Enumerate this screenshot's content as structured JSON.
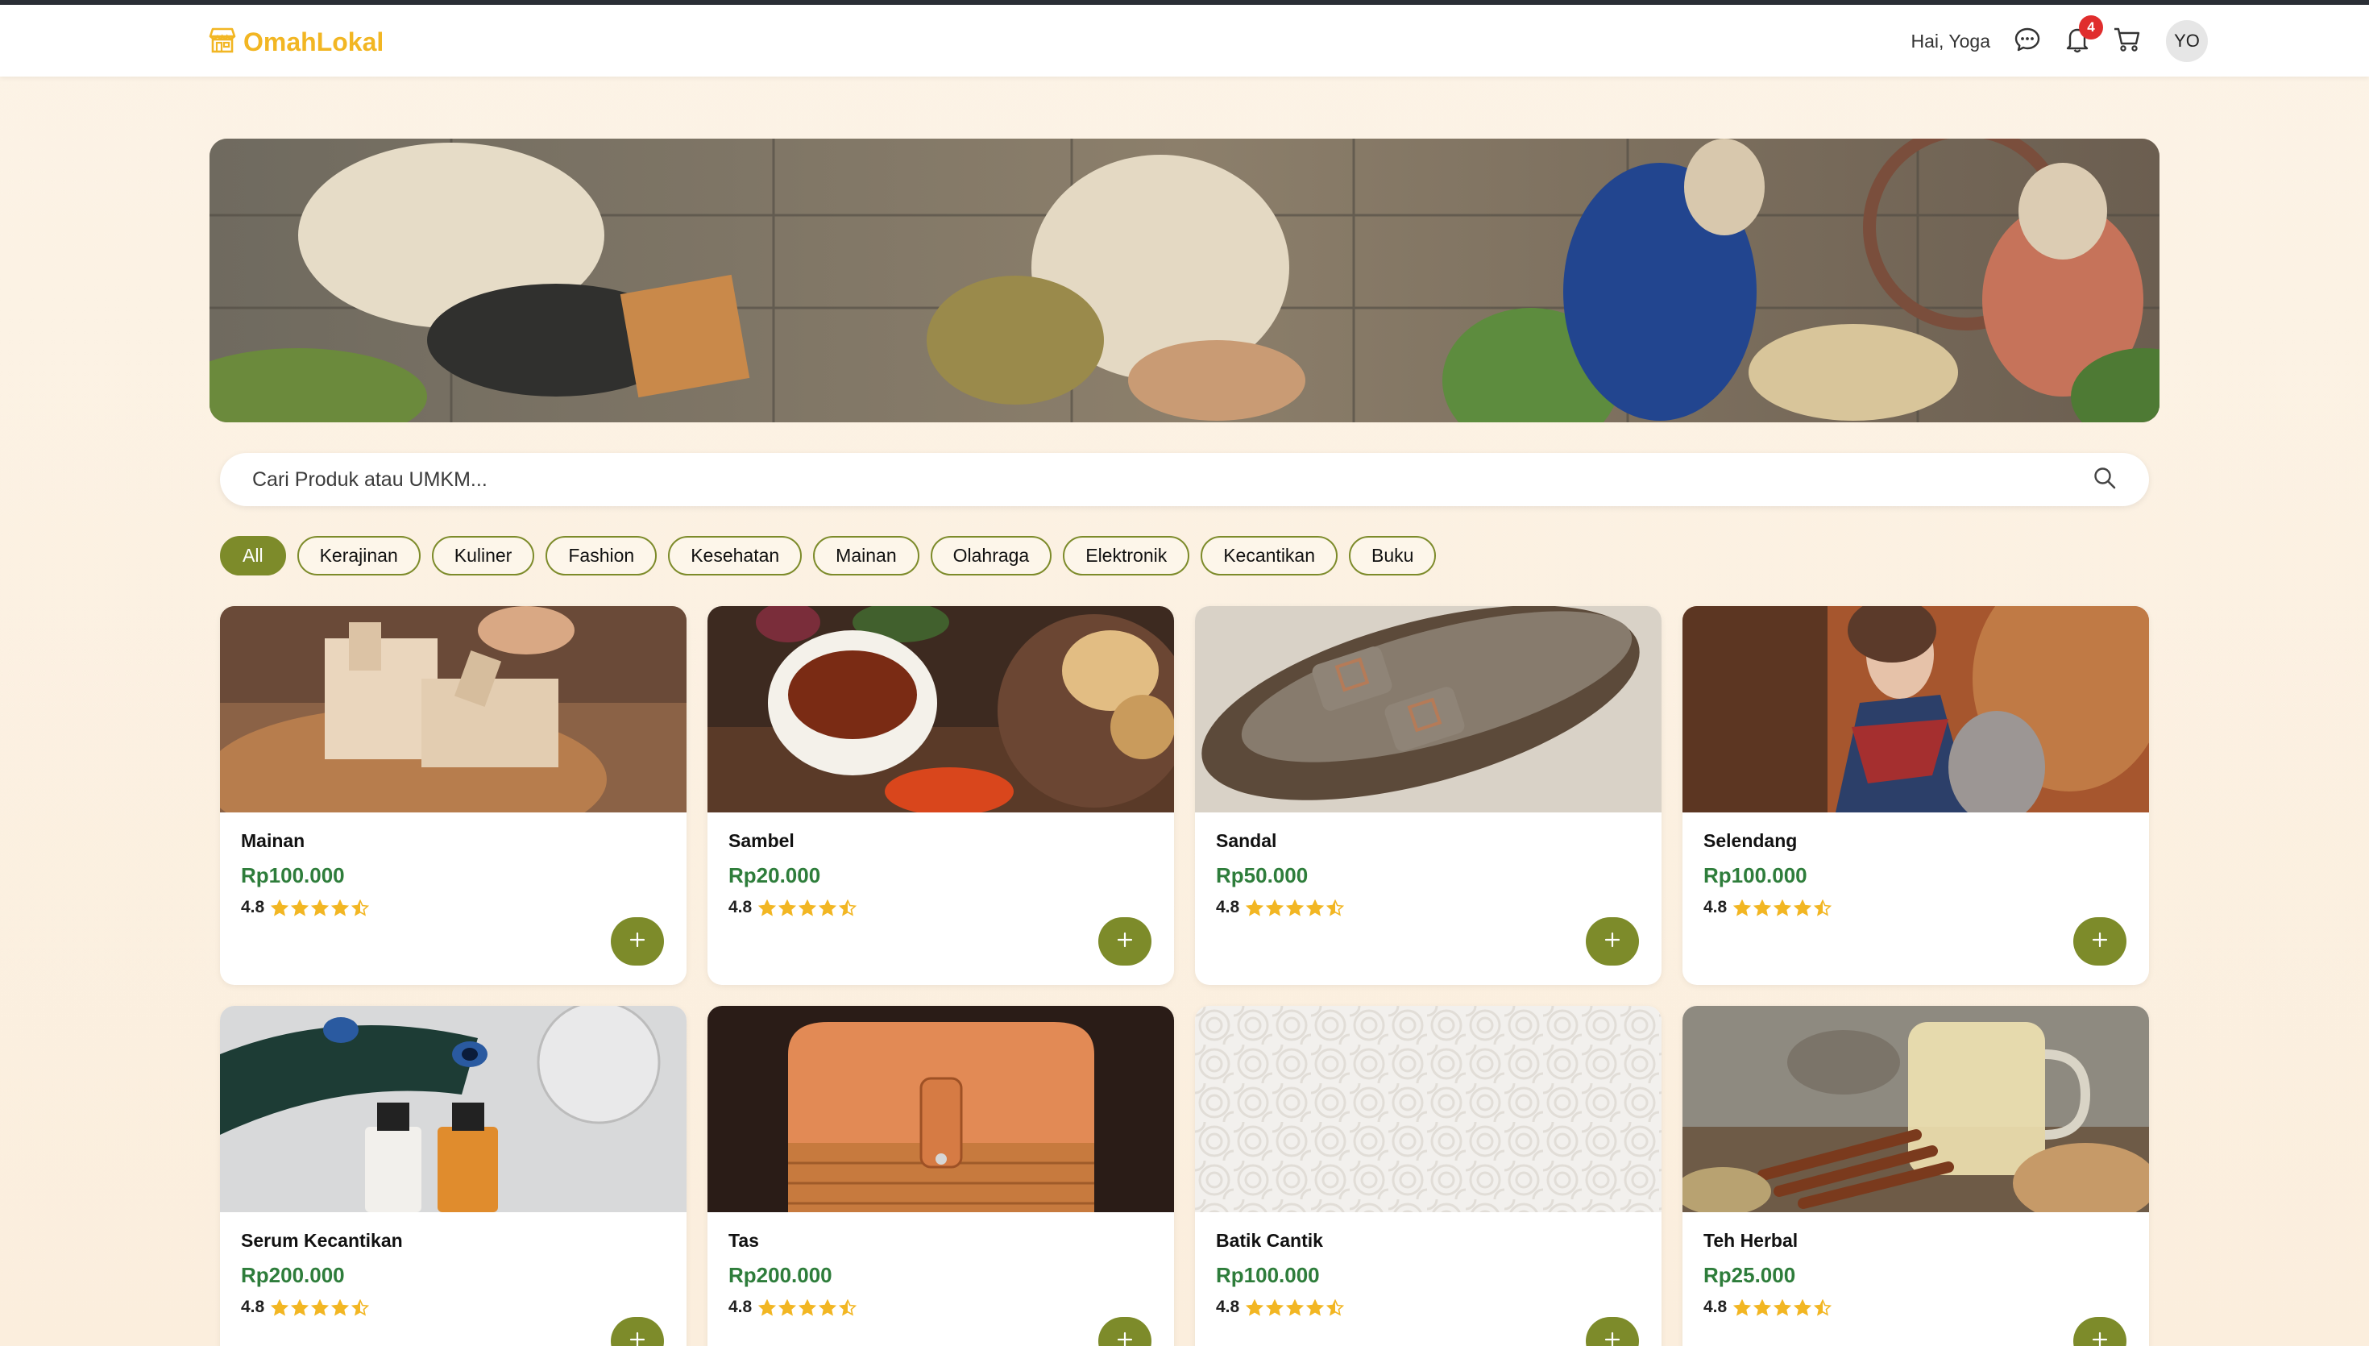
{
  "app": {
    "brand": "OmahLokal",
    "brand_icon": "store-icon",
    "colors": {
      "brand": "#f2b623",
      "accent": "#7d8b2a",
      "price": "#2e7d3b",
      "badge": "#e02d2d"
    }
  },
  "header": {
    "greeting": "Hai, Yoga",
    "icons": [
      "chat-icon",
      "bell-icon",
      "cart-icon"
    ],
    "notification_count": "4",
    "avatar_initials": "YO"
  },
  "banner": {
    "image": "hero-relief-banner"
  },
  "search": {
    "placeholder": "Cari Produk atau UMKM...",
    "value": ""
  },
  "categories": [
    {
      "label": "All",
      "active": true
    },
    {
      "label": "Kerajinan",
      "active": false
    },
    {
      "label": "Kuliner",
      "active": false
    },
    {
      "label": "Fashion",
      "active": false
    },
    {
      "label": "Kesehatan",
      "active": false
    },
    {
      "label": "Mainan",
      "active": false
    },
    {
      "label": "Olahraga",
      "active": false
    },
    {
      "label": "Elektronik",
      "active": false
    },
    {
      "label": "Kecantikan",
      "active": false
    },
    {
      "label": "Buku",
      "active": false
    }
  ],
  "products": [
    {
      "name": "Mainan",
      "price": "Rp100.000",
      "rating": "4.8",
      "stars": 4.5,
      "image": "wooden-toy-photo"
    },
    {
      "name": "Sambel",
      "price": "Rp20.000",
      "rating": "4.8",
      "stars": 4.5,
      "image": "sambal-bowl-photo"
    },
    {
      "name": "Sandal",
      "price": "Rp50.000",
      "rating": "4.8",
      "stars": 4.5,
      "image": "sandal-photo"
    },
    {
      "name": "Selendang",
      "price": "Rp100.000",
      "rating": "4.8",
      "stars": 4.5,
      "image": "scarf-woman-photo"
    },
    {
      "name": "Serum Kecantikan",
      "price": "Rp200.000",
      "rating": "4.8",
      "stars": 4.5,
      "image": "serum-bottles-photo"
    },
    {
      "name": "Tas",
      "price": "Rp200.000",
      "rating": "4.8",
      "stars": 4.5,
      "image": "leather-bag-photo"
    },
    {
      "name": "Batik Cantik",
      "price": "Rp100.000",
      "rating": "4.8",
      "stars": 4.5,
      "image": "batik-placeholder"
    },
    {
      "name": "Teh Herbal",
      "price": "Rp25.000",
      "rating": "4.8",
      "stars": 4.5,
      "image": "herbal-tea-photo"
    }
  ]
}
